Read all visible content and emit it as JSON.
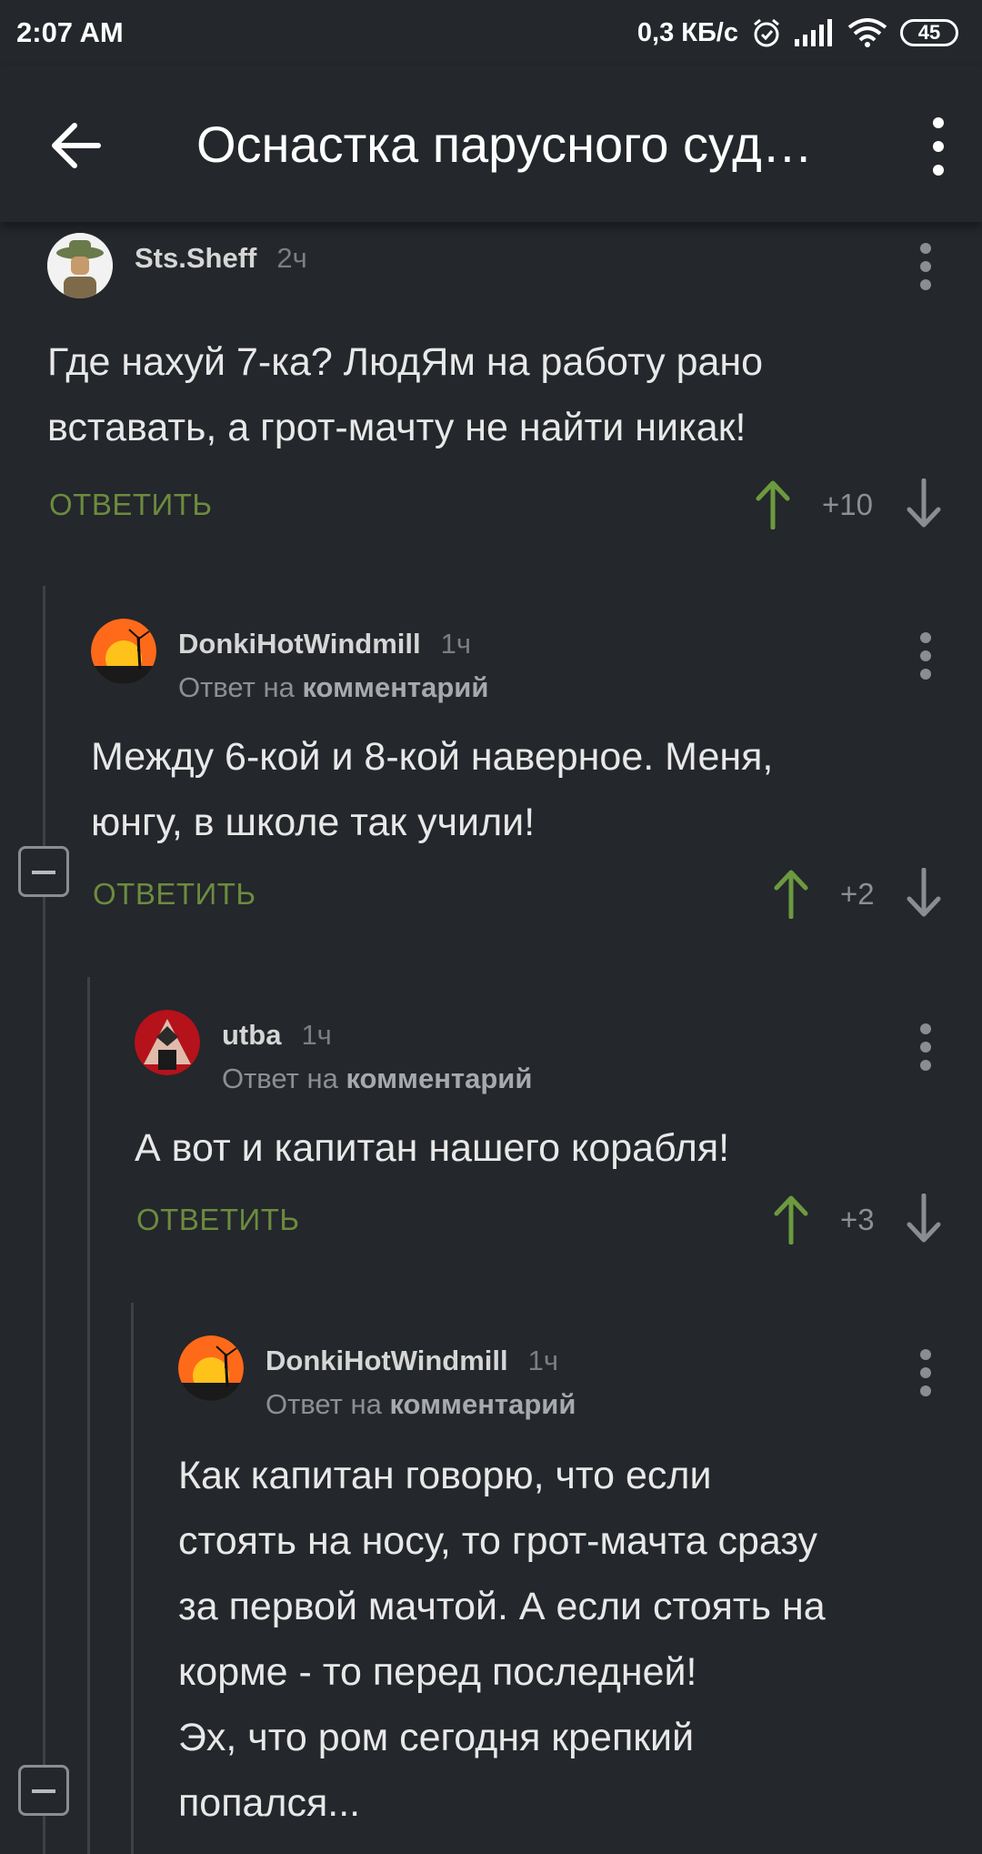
{
  "status_bar": {
    "time": "2:07 AM",
    "speed": "0,3 КБ/с",
    "battery": "45"
  },
  "app_bar": {
    "title": "Оснастка парусного суд…"
  },
  "comments": [
    {
      "username": "Sts.Sheff",
      "time": "2ч",
      "reply_prefix": "",
      "reply_target": "",
      "lines": [
        "Где нахуй 7-ка? ЛюдЯм на работу рано",
        "вставать, а грот-мачту не найти никак!"
      ],
      "reply_label": "ОТВЕТИТЬ",
      "score": "+10"
    },
    {
      "username": "DonkiHotWindmill",
      "time": "1ч",
      "reply_prefix": "Ответ на",
      "reply_target": "комментарий",
      "lines": [
        "Между 6-кой и 8-кой наверное. Меня,",
        "юнгу, в школе так учили!"
      ],
      "reply_label": "ОТВЕТИТЬ",
      "score": "+2"
    },
    {
      "username": "utba",
      "time": "1ч",
      "reply_prefix": "Ответ на",
      "reply_target": "комментарий",
      "lines": [
        "А вот и капитан нашего корабля!"
      ],
      "reply_label": "ОТВЕТИТЬ",
      "score": "+3"
    },
    {
      "username": "DonkiHotWindmill",
      "time": "1ч",
      "reply_prefix": "Ответ на",
      "reply_target": "комментарий",
      "lines": [
        "Как капитан говорю, что если",
        "стоять на носу, то грот-мачта сразу",
        "за первой мачтой. А если стоять на",
        "корме - то перед последней!",
        "Эх, что ром сегодня крепкий",
        "попался..."
      ]
    }
  ],
  "colors": {
    "background": "#24272b",
    "accent_green": "#6c8b3f",
    "upvote_green": "#6c9a3f",
    "muted_text": "#8c8f93"
  },
  "icons": [
    "back-arrow-icon",
    "more-vertical-icon",
    "upvote-arrow-icon",
    "downvote-arrow-icon",
    "collapse-icon",
    "alarm-icon",
    "signal-icon",
    "wifi-icon",
    "battery-icon"
  ]
}
